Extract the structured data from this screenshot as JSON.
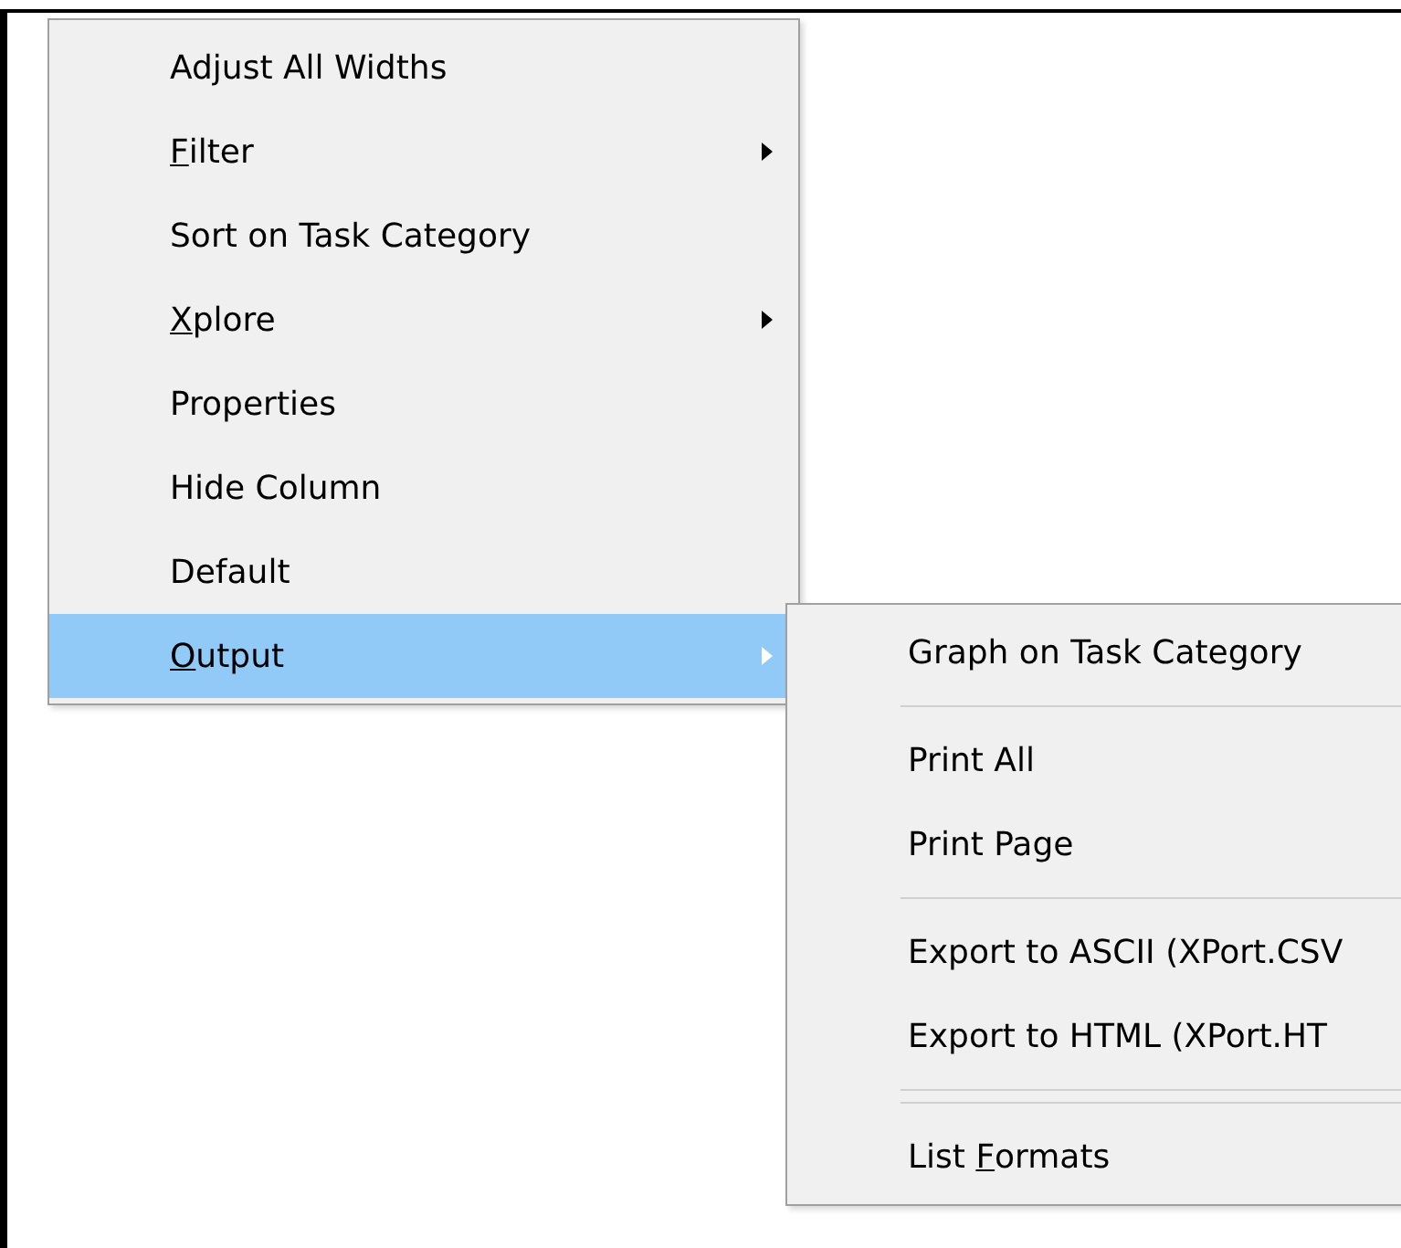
{
  "context_menu": {
    "items": [
      {
        "kind": "item",
        "parts": [
          {
            "text": "Adjust All Widths",
            "underline": false
          }
        ],
        "has_submenu": false,
        "selected": false
      },
      {
        "kind": "item",
        "parts": [
          {
            "text": "F",
            "underline": true
          },
          {
            "text": "ilter",
            "underline": false
          }
        ],
        "has_submenu": true,
        "selected": false
      },
      {
        "kind": "item",
        "parts": [
          {
            "text": "Sort on Task Category",
            "underline": false
          }
        ],
        "has_submenu": false,
        "selected": false
      },
      {
        "kind": "item",
        "parts": [
          {
            "text": "X",
            "underline": true
          },
          {
            "text": "plore",
            "underline": false
          }
        ],
        "has_submenu": true,
        "selected": false
      },
      {
        "kind": "item",
        "parts": [
          {
            "text": "Properties",
            "underline": false
          }
        ],
        "has_submenu": false,
        "selected": false
      },
      {
        "kind": "item",
        "parts": [
          {
            "text": "Hide Column",
            "underline": false
          }
        ],
        "has_submenu": false,
        "selected": false
      },
      {
        "kind": "item",
        "parts": [
          {
            "text": "Default",
            "underline": false
          }
        ],
        "has_submenu": false,
        "selected": false
      },
      {
        "kind": "item",
        "parts": [
          {
            "text": "O",
            "underline": true
          },
          {
            "text": "utput",
            "underline": false
          }
        ],
        "has_submenu": true,
        "selected": true
      }
    ]
  },
  "submenu": {
    "items": [
      {
        "kind": "item",
        "parts": [
          {
            "text": "Graph on Task Category",
            "underline": false
          }
        ],
        "selected": false
      },
      {
        "kind": "separator"
      },
      {
        "kind": "item",
        "parts": [
          {
            "text": "Print All",
            "underline": false
          }
        ],
        "selected": false
      },
      {
        "kind": "item",
        "parts": [
          {
            "text": "Print Page",
            "underline": false
          }
        ],
        "selected": false
      },
      {
        "kind": "separator"
      },
      {
        "kind": "item",
        "parts": [
          {
            "text": "Export to ASCII (XPort.CSV",
            "underline": false
          }
        ],
        "selected": false
      },
      {
        "kind": "item",
        "parts": [
          {
            "text": "Export to HTML (XPort.HT",
            "underline": false
          }
        ],
        "selected": false
      },
      {
        "kind": "separator"
      },
      {
        "kind": "separator"
      },
      {
        "kind": "item",
        "parts": [
          {
            "text": "List ",
            "underline": false
          },
          {
            "text": "F",
            "underline": true
          },
          {
            "text": "ormats",
            "underline": false
          }
        ],
        "selected": false
      }
    ]
  }
}
